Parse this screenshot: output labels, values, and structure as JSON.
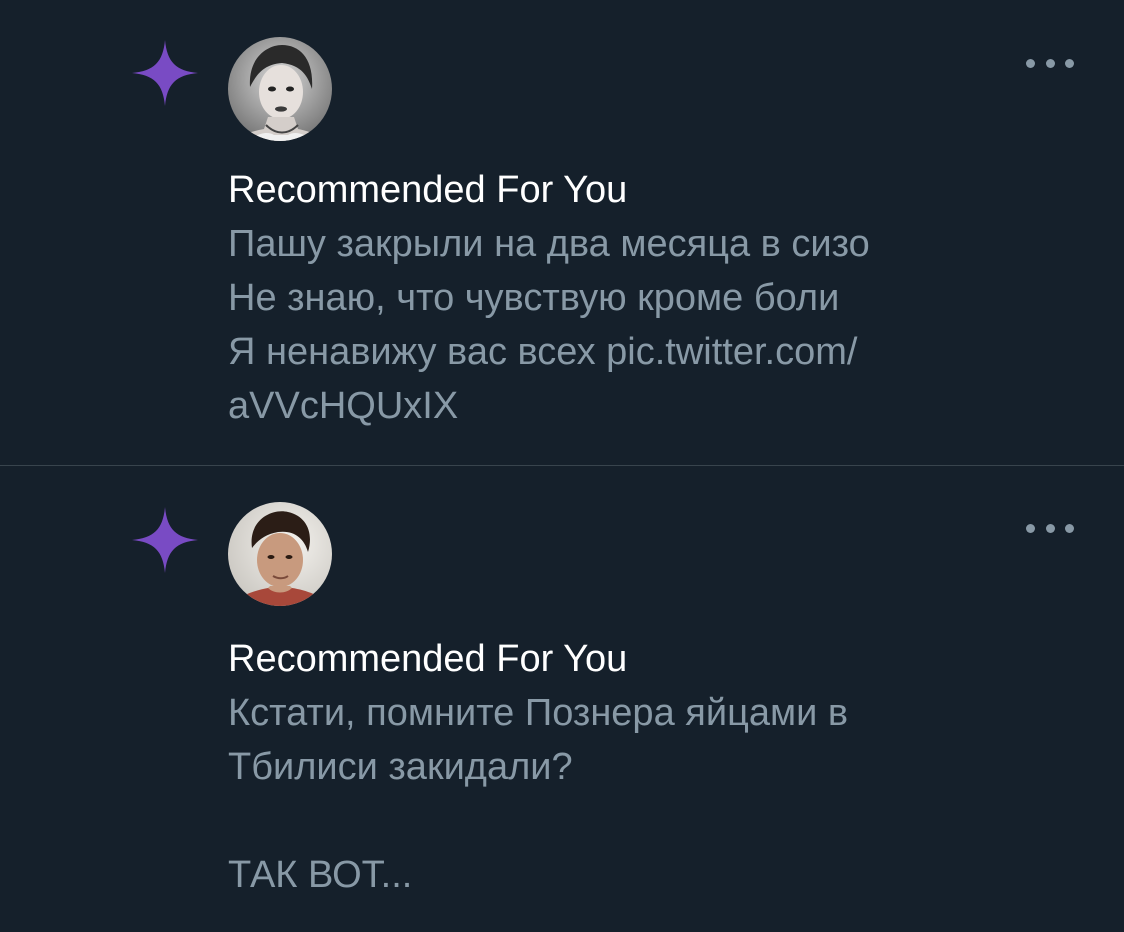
{
  "colors": {
    "background": "#15202b",
    "divider": "#38444d",
    "sparkle": "#794bc4",
    "title": "#ffffff",
    "body": "#8899a6"
  },
  "notifications": [
    {
      "icon": "sparkle-icon",
      "avatar": "user-avatar",
      "title": "Recommended For You",
      "lines": [
        "Пашу закрыли на два месяца в сизо",
        "Не знаю, что чувствую кроме боли",
        "Я ненавижу вас всех pic.twitter.com/",
        "aVVcHQUxIX"
      ]
    },
    {
      "icon": "sparkle-icon",
      "avatar": "user-avatar",
      "title": "Recommended For You",
      "lines": [
        "Кстати, помните Познера яйцами в",
        "Тбилиси закидали?",
        "",
        "ТАК ВОТ..."
      ]
    }
  ]
}
